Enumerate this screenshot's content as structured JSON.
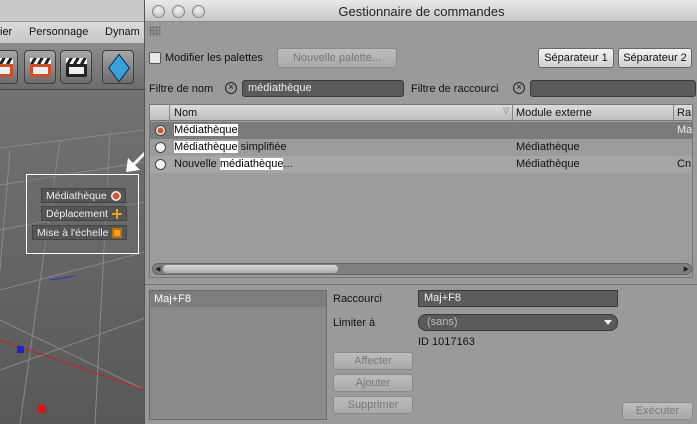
{
  "background_app": {
    "menu": [
      "ier",
      "Personnage",
      "Dynam"
    ],
    "tool_popup": {
      "items": [
        {
          "label": "Médiathèque",
          "icon": "record-icon"
        },
        {
          "label": "Déplacement",
          "icon": "move-icon"
        },
        {
          "label": "Mise à l'échelle",
          "icon": "scale-icon"
        }
      ]
    }
  },
  "window": {
    "title": "Gestionnaire de commandes"
  },
  "toolbar": {
    "edit_palettes_label": "Modifier les palettes",
    "new_palette_button": "Nouvelle palette...",
    "separator1_button": "Séparateur 1",
    "separator2_button": "Séparateur 2"
  },
  "filters": {
    "name_label": "Filtre de nom",
    "name_value": "médiathèque",
    "shortcut_label": "Filtre de raccourci",
    "shortcut_value": ""
  },
  "table": {
    "columns": {
      "name": "Nom",
      "plugin": "Module externe",
      "extra": "Ra"
    },
    "rows": [
      {
        "pre": "",
        "match": "Médiathèque",
        "post": "",
        "plugin": "",
        "extra": "Ma",
        "selected": true
      },
      {
        "pre": "",
        "match": "Médiathèque",
        "post": " simplifiée",
        "plugin": "Médiathèque",
        "extra": "",
        "selected": false
      },
      {
        "pre": "Nouvelle ",
        "match": "médiathèque",
        "post": "...",
        "plugin": "Médiathèque",
        "extra": "Cn",
        "selected": false
      }
    ]
  },
  "detail": {
    "shortcut_list_item": "Maj+F8",
    "shortcut_label": "Raccourci",
    "shortcut_value": "Maj+F8",
    "restrict_label": "Limiter à",
    "restrict_value": "(sans)",
    "id_text": "ID 1017163",
    "assign_button": "Affecter",
    "add_button": "Ajouter",
    "delete_button": "Supprimer",
    "execute_button": "Exécuter"
  }
}
